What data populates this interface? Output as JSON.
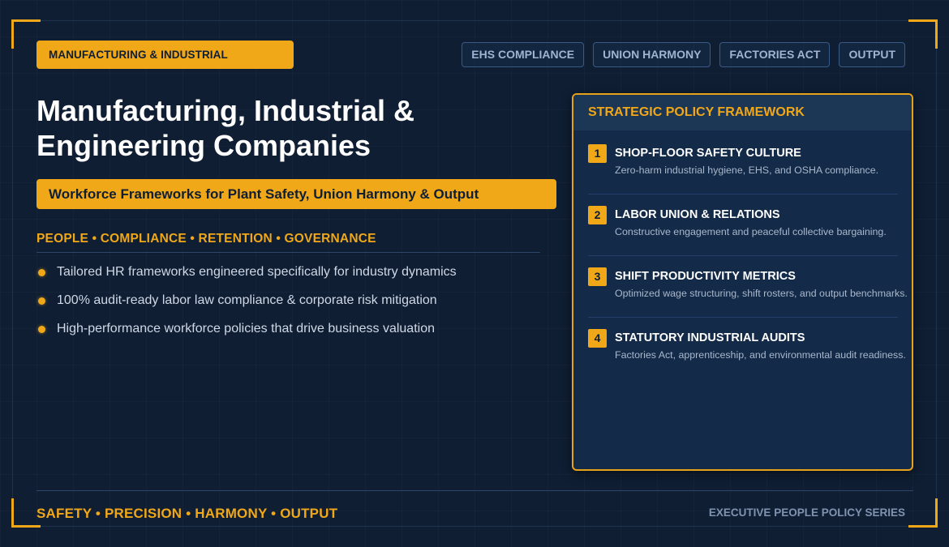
{
  "category_badge": "MANUFACTURING & INDUSTRIAL",
  "tags": [
    "EHS COMPLIANCE",
    "UNION HARMONY",
    "FACTORIES ACT",
    "OUTPUT"
  ],
  "title_line1": "Manufacturing, Industrial &",
  "title_line2": "Engineering Companies",
  "subtitle": "Workforce Frameworks for Plant Safety, Union Harmony & Output",
  "pillars": "PEOPLE • COMPLIANCE • RETENTION • GOVERNANCE",
  "bullets": [
    "Tailored HR frameworks engineered specifically for industry dynamics",
    "100% audit-ready labor law compliance & corporate risk mitigation",
    "High-performance workforce policies that drive business valuation"
  ],
  "panel": {
    "title": "STRATEGIC POLICY FRAMEWORK",
    "items": [
      {
        "num": "1",
        "title": "SHOP-FLOOR SAFETY CULTURE",
        "desc": "Zero-harm industrial hygiene, EHS, and OSHA compliance."
      },
      {
        "num": "2",
        "title": "LABOR UNION & RELATIONS",
        "desc": "Constructive engagement and peaceful collective bargaining."
      },
      {
        "num": "3",
        "title": "SHIFT PRODUCTIVITY METRICS",
        "desc": "Optimized wage structuring, shift rosters, and output benchmarks."
      },
      {
        "num": "4",
        "title": "STATUTORY INDUSTRIAL AUDITS",
        "desc": "Factories Act, apprenticeship, and environmental audit readiness."
      }
    ]
  },
  "footer_left": "SAFETY • PRECISION • HARMONY • OUTPUT",
  "footer_right": "EXECUTIVE PEOPLE POLICY SERIES",
  "colors": {
    "accent": "#f0a818",
    "background": "#0f1e33",
    "panel": "#132a48"
  }
}
